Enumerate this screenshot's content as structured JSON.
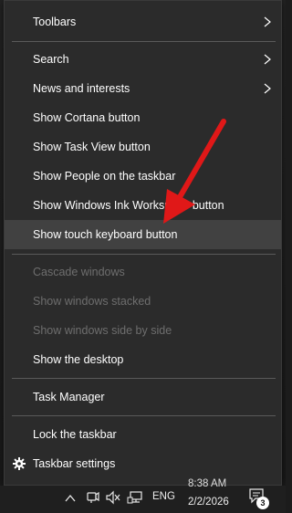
{
  "menu": {
    "items": [
      {
        "label": "Toolbars"
      },
      {
        "label": "Search"
      },
      {
        "label": "News and interests"
      },
      {
        "label": "Show Cortana button"
      },
      {
        "label": "Show Task View button"
      },
      {
        "label": "Show People on the taskbar"
      },
      {
        "label": "Show Windows Ink Workspace button"
      },
      {
        "label": "Show touch keyboard button"
      },
      {
        "label": "Cascade windows"
      },
      {
        "label": "Show windows stacked"
      },
      {
        "label": "Show windows side by side"
      },
      {
        "label": "Show the desktop"
      },
      {
        "label": "Task Manager"
      },
      {
        "label": "Lock the taskbar"
      },
      {
        "label": "Taskbar settings"
      }
    ]
  },
  "tray": {
    "language": "ENG",
    "time": "8:38 AM",
    "date": "2/2/2026",
    "notification_count": "3"
  },
  "colors": {
    "menu_bg": "#2b2b2b",
    "highlight": "#414141",
    "disabled_text": "#6e6e6e",
    "annotation_arrow": "#e01818"
  },
  "icons": [
    "chevron-right-icon",
    "gear-icon",
    "chevron-up-icon",
    "meet-now-icon",
    "speaker-muted-icon",
    "network-icon",
    "notification-icon"
  ]
}
